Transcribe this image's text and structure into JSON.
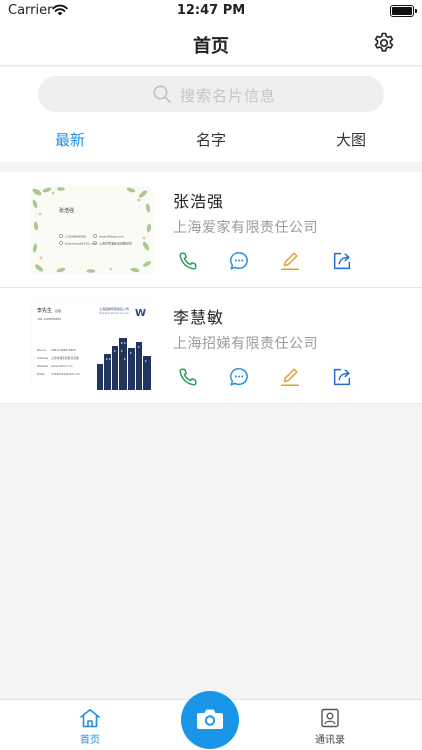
{
  "status_bar": {
    "carrier": "Carrier",
    "time": "12:47 PM",
    "battery_level": 1.0
  },
  "nav": {
    "title": "首页",
    "settings_icon": "gear-icon"
  },
  "search": {
    "placeholder": "搜索名片信息",
    "icon": "search-icon"
  },
  "tabs": [
    {
      "label": "最新",
      "active": true
    },
    {
      "label": "名字",
      "active": false
    },
    {
      "label": "大图",
      "active": false
    }
  ],
  "cards": [
    {
      "name": "张浩强",
      "company": "上海爱家有限责任公司",
      "thumb": {
        "name": "张浩强",
        "lines": [
          "13838888888",
          "www.888qq.com",
          "zhanhaoqi@126.com",
          "上海市黄浦区某某路某号"
        ]
      }
    },
    {
      "name": "李慧敏",
      "company": "上海招娣有限责任公司",
      "thumb": {
        "name": "李先生",
        "title": "经理",
        "company": "上海招娣有限责任公司",
        "company_en": "Shanghai Zhaodi Co.,Ltd",
        "phone": "186 1898888888",
        "logo": "W",
        "fields": [
          [
            "Phone",
            "18011098876610"
          ],
          [
            "Address",
            "上海市浦东新区某某路"
          ],
          [
            "Website",
            "www.123d.com"
          ],
          [
            "Email",
            "13398222@163.com"
          ]
        ]
      }
    }
  ],
  "actions": {
    "phone": "phone-icon",
    "message": "message-icon",
    "edit": "edit-icon",
    "share": "share-icon"
  },
  "colors": {
    "accent": "#1f8ee6",
    "phone": "#2e9e5b",
    "message": "#1f8ee6",
    "edit": "#e0a030",
    "share": "#1f6fd0"
  },
  "tabbar": {
    "home_label": "首页",
    "contacts_label": "通讯录",
    "camera_icon": "camera-icon"
  }
}
